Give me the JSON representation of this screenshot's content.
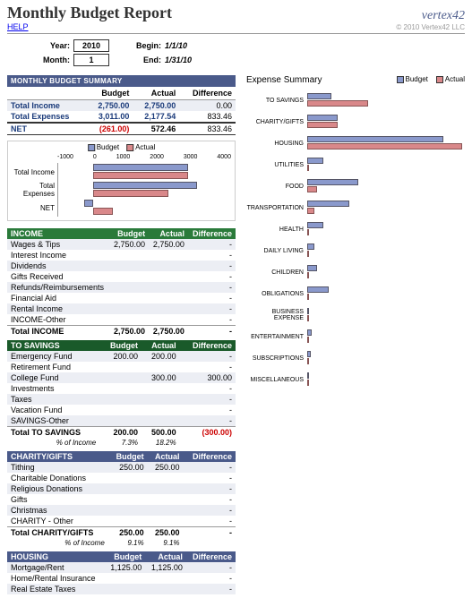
{
  "header": {
    "title": "Monthly Budget Report",
    "help": "HELP",
    "brand": "vertex42",
    "copyright": "© 2010 Vertex42 LLC"
  },
  "controls": {
    "year_label": "Year:",
    "year_value": "2010",
    "month_label": "Month:",
    "month_value": "1",
    "begin_label": "Begin:",
    "begin_value": "1/1/10",
    "end_label": "End:",
    "end_value": "1/31/10"
  },
  "summary": {
    "title": "MONTHLY BUDGET SUMMARY",
    "cols": [
      "",
      "Budget",
      "Actual",
      "Difference"
    ],
    "rows": [
      {
        "label": "Total Income",
        "budget": "2,750.00",
        "actual": "2,750.00",
        "diff": "0.00"
      },
      {
        "label": "Total Expenses",
        "budget": "3,011.00",
        "actual": "2,177.54",
        "diff": "833.46"
      }
    ],
    "net": {
      "label": "NET",
      "budget": "(261.00)",
      "actual": "572.46",
      "diff": "833.46"
    }
  },
  "chart_data": {
    "type": "bar",
    "orientation": "horizontal",
    "series_names": [
      "Budget",
      "Actual"
    ],
    "xticks": [
      -1000,
      0,
      1000,
      2000,
      3000,
      4000
    ],
    "categories": [
      "Total Income",
      "Total Expenses",
      "NET"
    ],
    "series": [
      {
        "name": "Budget",
        "values": [
          2750,
          3011,
          -261
        ]
      },
      {
        "name": "Actual",
        "values": [
          2750,
          2177.54,
          572.46
        ]
      }
    ]
  },
  "categories": [
    {
      "name": "INCOME",
      "headerClass": "cat-green",
      "cols": [
        "Budget",
        "Actual",
        "Difference"
      ],
      "rows": [
        {
          "label": "Wages & Tips",
          "budget": "2,750.00",
          "actual": "2,750.00",
          "diff": "-"
        },
        {
          "label": "Interest Income",
          "budget": "",
          "actual": "",
          "diff": "-"
        },
        {
          "label": "Dividends",
          "budget": "",
          "actual": "",
          "diff": "-"
        },
        {
          "label": "Gifts Received",
          "budget": "",
          "actual": "",
          "diff": "-"
        },
        {
          "label": "Refunds/Reimbursements",
          "budget": "",
          "actual": "",
          "diff": "-"
        },
        {
          "label": "Financial Aid",
          "budget": "",
          "actual": "",
          "diff": "-"
        },
        {
          "label": "Rental Income",
          "budget": "",
          "actual": "",
          "diff": "-"
        },
        {
          "label": "INCOME-Other",
          "budget": "",
          "actual": "",
          "diff": "-"
        }
      ],
      "total": {
        "label": "Total INCOME",
        "budget": "2,750.00",
        "actual": "2,750.00",
        "diff": "-"
      }
    },
    {
      "name": "TO SAVINGS",
      "headerClass": "cat-dgreen",
      "cols": [
        "Budget",
        "Actual",
        "Difference"
      ],
      "rows": [
        {
          "label": "Emergency Fund",
          "budget": "200.00",
          "actual": "200.00",
          "diff": "-"
        },
        {
          "label": "Retirement Fund",
          "budget": "",
          "actual": "",
          "diff": "-"
        },
        {
          "label": "College Fund",
          "budget": "",
          "actual": "300.00",
          "diff": "300.00"
        },
        {
          "label": "Investments",
          "budget": "",
          "actual": "",
          "diff": "-"
        },
        {
          "label": "Taxes",
          "budget": "",
          "actual": "",
          "diff": "-"
        },
        {
          "label": "Vacation Fund",
          "budget": "",
          "actual": "",
          "diff": "-"
        },
        {
          "label": "SAVINGS-Other",
          "budget": "",
          "actual": "",
          "diff": "-"
        }
      ],
      "total": {
        "label": "Total TO SAVINGS",
        "budget": "200.00",
        "actual": "500.00",
        "diff": "(300.00)"
      },
      "pct": {
        "label": "% of Income",
        "budget": "7.3%",
        "actual": "18.2%"
      }
    },
    {
      "name": "CHARITY/GIFTS",
      "headerClass": "cat-blue",
      "cols": [
        "Budget",
        "Actual",
        "Difference"
      ],
      "rows": [
        {
          "label": "Tithing",
          "budget": "250.00",
          "actual": "250.00",
          "diff": "-"
        },
        {
          "label": "Charitable Donations",
          "budget": "",
          "actual": "",
          "diff": "-"
        },
        {
          "label": "Religious Donations",
          "budget": "",
          "actual": "",
          "diff": "-"
        },
        {
          "label": "Gifts",
          "budget": "",
          "actual": "",
          "diff": "-"
        },
        {
          "label": "Christmas",
          "budget": "",
          "actual": "",
          "diff": "-"
        },
        {
          "label": "CHARITY - Other",
          "budget": "",
          "actual": "",
          "diff": "-"
        }
      ],
      "total": {
        "label": "Total CHARITY/GIFTS",
        "budget": "250.00",
        "actual": "250.00",
        "diff": "-"
      },
      "pct": {
        "label": "% of Income",
        "budget": "9.1%",
        "actual": "9.1%"
      }
    },
    {
      "name": "HOUSING",
      "headerClass": "cat-blue",
      "cols": [
        "Budget",
        "Actual",
        "Difference"
      ],
      "rows": [
        {
          "label": "Mortgage/Rent",
          "budget": "1,125.00",
          "actual": "1,125.00",
          "diff": "-"
        },
        {
          "label": "Home/Rental Insurance",
          "budget": "",
          "actual": "",
          "diff": "-"
        },
        {
          "label": "Real Estate Taxes",
          "budget": "",
          "actual": "",
          "diff": "-"
        }
      ]
    }
  ],
  "expense_summary": {
    "title": "Expense Summary",
    "legend": [
      "Budget",
      "Actual"
    ],
    "max": 1300,
    "items": [
      {
        "label": "TO SAVINGS",
        "budget": 200,
        "actual": 500
      },
      {
        "label": "CHARITY/GIFTS",
        "budget": 250,
        "actual": 250
      },
      {
        "label": "HOUSING",
        "budget": 1125,
        "actual": 1275
      },
      {
        "label": "UTILITIES",
        "budget": 130,
        "actual": 0
      },
      {
        "label": "FOOD",
        "budget": 420,
        "actual": 80
      },
      {
        "label": "TRANSPORTATION",
        "budget": 350,
        "actual": 60
      },
      {
        "label": "HEALTH",
        "budget": 130,
        "actual": 0
      },
      {
        "label": "DAILY LIVING",
        "budget": 60,
        "actual": 0
      },
      {
        "label": "CHILDREN",
        "budget": 80,
        "actual": 0
      },
      {
        "label": "OBLIGATIONS",
        "budget": 180,
        "actual": 0
      },
      {
        "label": "BUSINESS EXPENSE",
        "budget": 0,
        "actual": 0
      },
      {
        "label": "ENTERTAINMENT",
        "budget": 40,
        "actual": 0
      },
      {
        "label": "SUBSCRIPTIONS",
        "budget": 30,
        "actual": 0
      },
      {
        "label": "MISCELLANEOUS",
        "budget": 0,
        "actual": 0
      }
    ]
  }
}
